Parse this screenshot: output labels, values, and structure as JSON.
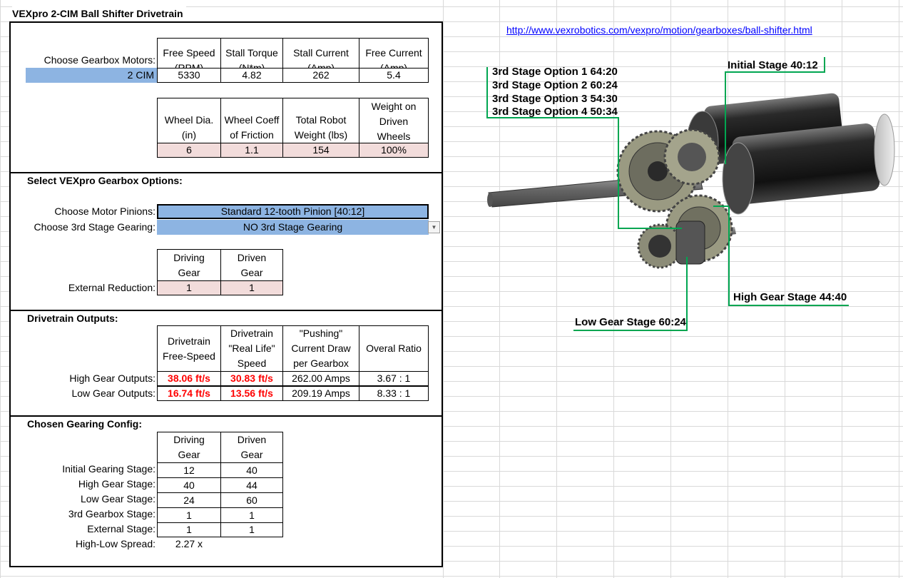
{
  "title": "VEXpro 2-CIM Ball Shifter Drivetrain",
  "link": "http://www.vexrobotics.com/vexpro/motion/gearboxes/ball-shifter.html",
  "motors": {
    "label": "Choose Gearbox Motors:",
    "selected": "2 CIM",
    "headers": [
      [
        "Free Speed",
        "(RPM)"
      ],
      [
        "Stall Torque",
        "(N*m)"
      ],
      [
        "Stall Current",
        "(Amp)"
      ],
      [
        "Free Current",
        "(Amp)"
      ]
    ],
    "values": [
      "5330",
      "4.82",
      "262",
      "5.4"
    ]
  },
  "wheels": {
    "headers": [
      [
        "Wheel Dia.",
        "(in)"
      ],
      [
        "Wheel Coeff",
        "of Friction"
      ],
      [
        "Total Robot",
        "Weight (lbs)"
      ],
      [
        "Weight on",
        "Driven",
        "Wheels"
      ]
    ],
    "values": [
      "6",
      "1.1",
      "154",
      "100%"
    ]
  },
  "options": {
    "heading": "Select VEXpro Gearbox Options:",
    "pinion_label": "Choose Motor Pinions:",
    "pinion_value": "Standard 12-tooth Pinion [40:12]",
    "third_label": "Choose 3rd Stage Gearing:",
    "third_value": "NO 3rd Stage Gearing",
    "ext_headers": [
      [
        "Driving",
        "Gear"
      ],
      [
        "Driven",
        "Gear"
      ]
    ],
    "ext_label": "External Reduction:",
    "ext_values": [
      "1",
      "1"
    ]
  },
  "outputs": {
    "heading": "Drivetrain Outputs:",
    "headers": [
      [
        "Drivetrain",
        "Free-Speed"
      ],
      [
        "Drivetrain",
        "\"Real Life\"",
        "Speed"
      ],
      [
        "\"Pushing\"",
        "Current Draw",
        "per Gearbox"
      ],
      [
        "Overal Ratio"
      ]
    ],
    "rows": [
      {
        "label": "High Gear Outputs:",
        "free": "38.06 ft/s",
        "real": "30.83 ft/s",
        "current": "262.00 Amps",
        "ratio": "3.67 : 1"
      },
      {
        "label": "Low Gear Outputs:",
        "free": "16.74 ft/s",
        "real": "13.56 ft/s",
        "current": "209.19 Amps",
        "ratio": "8.33 : 1"
      }
    ]
  },
  "config": {
    "heading": "Chosen Gearing Config:",
    "headers": [
      [
        "Driving",
        "Gear"
      ],
      [
        "Driven",
        "Gear"
      ]
    ],
    "rows": [
      {
        "label": "Initial Gearing Stage:",
        "driving": "12",
        "driven": "40"
      },
      {
        "label": "High Gear Stage:",
        "driving": "40",
        "driven": "44"
      },
      {
        "label": "Low Gear Stage:",
        "driving": "24",
        "driven": "60"
      },
      {
        "label": "3rd Gearbox Stage:",
        "driving": "1",
        "driven": "1"
      },
      {
        "label": "External Stage:",
        "driving": "1",
        "driven": "1"
      }
    ],
    "spread_label": "High-Low Spread:",
    "spread_value": "2.27 x"
  },
  "diagram": {
    "third_options": [
      "3rd Stage Option 1 64:20",
      "3rd Stage Option 2 60:24",
      "3rd Stage Option 3 54:30",
      "3rd Stage Option 4 50:34"
    ],
    "initial": "Initial Stage 40:12",
    "high": "High Gear Stage 44:40",
    "low": "Low Gear Stage 60:24"
  }
}
